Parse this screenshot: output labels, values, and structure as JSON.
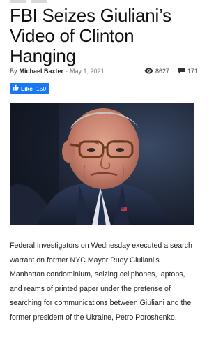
{
  "article": {
    "title": "FBI Seizes Giuliani’s Video of Clinton Hanging",
    "by_label": "By",
    "author": "Michael Baxter",
    "separator": "-",
    "date": "May 1, 2021",
    "views": "8627",
    "comments": "171",
    "like": {
      "label": "Like",
      "count": "150"
    },
    "body": "Federal Investigators on Wednesday executed a search warrant on former NYC Mayor Rudy Giuliani’s Manhattan condominium, seizing cellphones, laptops, and reams of printed paper under the pretense of searching for communications between Giuliani and the former president of the Ukraine, Petro Poroshenko."
  },
  "icons": {
    "views": "eye-icon",
    "comments": "comment-icon",
    "like": "thumbs-up-icon"
  },
  "colors": {
    "like_button": "#1877f2",
    "headline": "#111111",
    "body_text": "#222222"
  }
}
